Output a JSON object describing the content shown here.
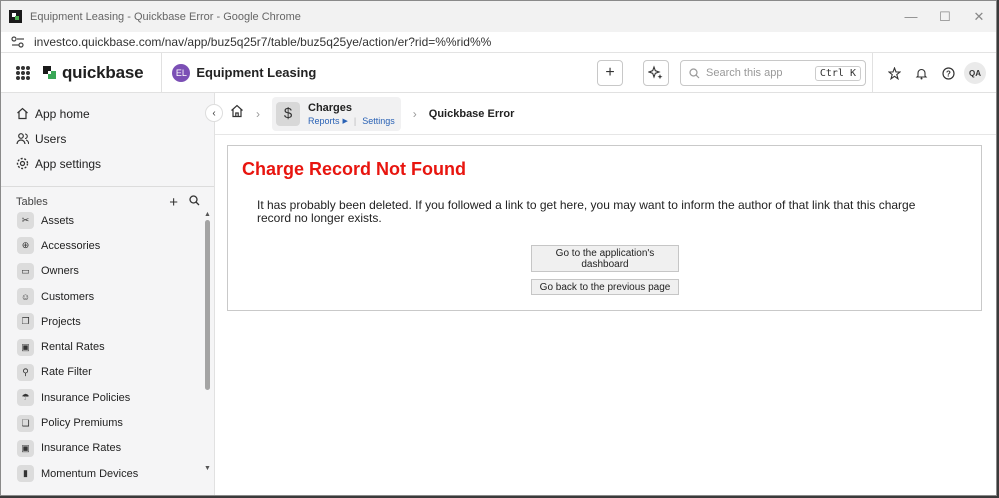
{
  "window": {
    "title": "Equipment Leasing - Quickbase Error - Google Chrome",
    "url": "investco.quickbase.com/nav/app/buz5q25r7/table/buz5q25ye/action/er?rid=%%rid%%"
  },
  "header": {
    "brand": "quickbase",
    "app_badge": "EL",
    "app_name": "Equipment Leasing",
    "search_placeholder": "Search this app",
    "shortcut": "Ctrl K",
    "avatar": "QA"
  },
  "sidebar": {
    "top_items": [
      {
        "label": "App home",
        "icon": "home-icon"
      },
      {
        "label": "Users",
        "icon": "users-icon"
      },
      {
        "label": "App settings",
        "icon": "gear-icon"
      }
    ],
    "tables_label": "Tables",
    "tables": [
      {
        "label": "Assets",
        "icon": "tools-icon",
        "glyph": "✂"
      },
      {
        "label": "Accessories",
        "icon": "accessory-icon",
        "glyph": "⊕"
      },
      {
        "label": "Owners",
        "icon": "folder-icon",
        "glyph": "▭"
      },
      {
        "label": "Customers",
        "icon": "smiley-icon",
        "glyph": "☺"
      },
      {
        "label": "Projects",
        "icon": "projects-icon",
        "glyph": "❐"
      },
      {
        "label": "Rental Rates",
        "icon": "rate-icon",
        "glyph": "▣"
      },
      {
        "label": "Rate Filter",
        "icon": "binoculars-icon",
        "glyph": "⚲"
      },
      {
        "label": "Insurance Policies",
        "icon": "umbrella-icon",
        "glyph": "☂"
      },
      {
        "label": "Policy Premiums",
        "icon": "premium-icon",
        "glyph": "❏"
      },
      {
        "label": "Insurance Rates",
        "icon": "monitor-icon",
        "glyph": "▣"
      },
      {
        "label": "Momentum Devices",
        "icon": "device-icon",
        "glyph": "▮"
      }
    ]
  },
  "breadcrumb": {
    "table_name": "Charges",
    "reports_link": "Reports",
    "settings_link": "Settings",
    "current": "Quickbase Error"
  },
  "error": {
    "title": "Charge Record Not Found",
    "message": "It has probably been deleted. If you followed a link to get here, you may want to inform the author of that link that this charge record no longer exists.",
    "dashboard_button": "Go to the application's dashboard",
    "back_button": "Go back to the previous page"
  }
}
